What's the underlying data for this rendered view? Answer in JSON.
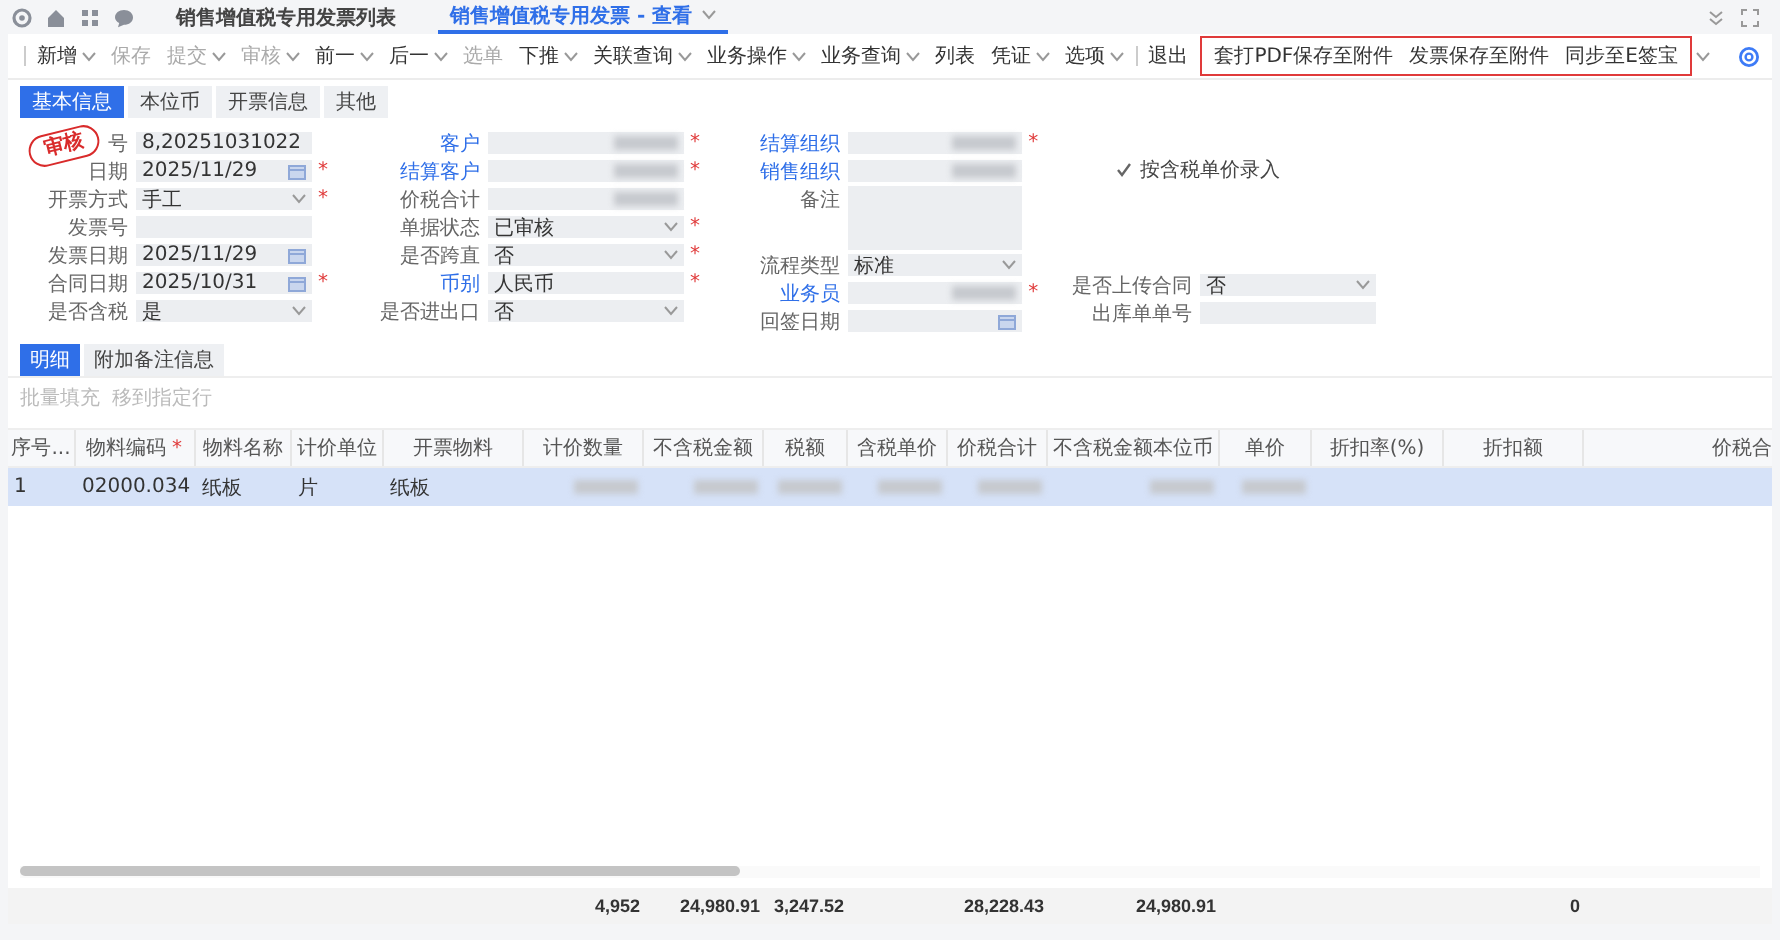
{
  "page_tabs": [
    {
      "label": "销售增值税专用发票列表",
      "selected": false,
      "closable": false
    },
    {
      "label": "销售增值税专用发票 - 查看",
      "selected": true,
      "closable": true
    }
  ],
  "toolbar": [
    {
      "kind": "separator"
    },
    {
      "kind": "button",
      "label": "新增",
      "dropdown": true,
      "disabled": false,
      "highlighted": false
    },
    {
      "kind": "button",
      "label": "保存",
      "dropdown": false,
      "disabled": true,
      "highlighted": false
    },
    {
      "kind": "button",
      "label": "提交",
      "dropdown": true,
      "disabled": true,
      "highlighted": false
    },
    {
      "kind": "button",
      "label": "审核",
      "dropdown": true,
      "disabled": true,
      "highlighted": false
    },
    {
      "kind": "button",
      "label": "前一",
      "dropdown": true,
      "disabled": false,
      "highlighted": false
    },
    {
      "kind": "button",
      "label": "后一",
      "dropdown": true,
      "disabled": false,
      "highlighted": false
    },
    {
      "kind": "button",
      "label": "选单",
      "dropdown": false,
      "disabled": true,
      "highlighted": false
    },
    {
      "kind": "button",
      "label": "下推",
      "dropdown": true,
      "disabled": false,
      "highlighted": false
    },
    {
      "kind": "button",
      "label": "关联查询",
      "dropdown": true,
      "disabled": false,
      "highlighted": false
    },
    {
      "kind": "button",
      "label": "业务操作",
      "dropdown": true,
      "disabled": false,
      "highlighted": false
    },
    {
      "kind": "button",
      "label": "业务查询",
      "dropdown": true,
      "disabled": false,
      "highlighted": false
    },
    {
      "kind": "button",
      "label": "列表",
      "dropdown": false,
      "disabled": false,
      "highlighted": false
    },
    {
      "kind": "button",
      "label": "凭证",
      "dropdown": true,
      "disabled": false,
      "highlighted": false
    },
    {
      "kind": "button",
      "label": "选项",
      "dropdown": true,
      "disabled": false,
      "highlighted": false
    },
    {
      "kind": "separator"
    },
    {
      "kind": "button",
      "label": "退出",
      "dropdown": false,
      "disabled": false,
      "highlighted": false
    },
    {
      "kind": "button",
      "label": "套打PDF保存至附件",
      "dropdown": false,
      "disabled": false,
      "highlighted": true
    },
    {
      "kind": "button",
      "label": "发票保存至附件",
      "dropdown": false,
      "disabled": false,
      "highlighted": true
    },
    {
      "kind": "button",
      "label": "同步至E签宝",
      "dropdown": false,
      "disabled": false,
      "highlighted": true
    }
  ],
  "form_tabs": [
    {
      "label": "基本信息",
      "selected": true
    },
    {
      "label": "本位币",
      "selected": false
    },
    {
      "label": "开票信息",
      "selected": false
    },
    {
      "label": "其他",
      "selected": false
    }
  ],
  "stamp": {
    "text": "审核"
  },
  "form_columns": [
    [
      {
        "label": "号",
        "kind": "text",
        "value": "8,20251031022"
      },
      {
        "label": "日期",
        "kind": "date",
        "value": "2025/11/29",
        "mark": "*"
      },
      {
        "label": "开票方式",
        "kind": "select",
        "value": "手工",
        "mark": "*"
      },
      {
        "label": "发票号",
        "kind": "text"
      },
      {
        "label": "发票日期",
        "kind": "date",
        "value": "2025/11/29"
      },
      {
        "label": "合同日期",
        "kind": "date",
        "value": "2025/10/31",
        "mark": "*"
      },
      {
        "label": "是否含税",
        "kind": "select",
        "value": "是"
      }
    ],
    [
      {
        "label": "客户",
        "kind": "blurred",
        "link": true,
        "mark": "*"
      },
      {
        "label": "结算客户",
        "kind": "blurred",
        "link": true,
        "mark": "*"
      },
      {
        "label": "价税合计",
        "kind": "blurred"
      },
      {
        "label": "单据状态",
        "kind": "select",
        "value": "已审核",
        "mark": "*"
      },
      {
        "label": "是否跨直",
        "kind": "select",
        "value": "否",
        "mark": "*"
      },
      {
        "label": "币别",
        "kind": "text",
        "value": "人民币",
        "link": true,
        "mark": "*"
      },
      {
        "label": "是否进出口",
        "kind": "select",
        "value": "否"
      }
    ],
    [
      {
        "label": "结算组织",
        "kind": "blurred",
        "link": true,
        "mark": "*"
      },
      {
        "label": "销售组织",
        "kind": "blurred",
        "link": true
      },
      {
        "label": "备注",
        "kind": "textarea"
      },
      {
        "label": "流程类型",
        "kind": "select",
        "value": "标准"
      },
      {
        "label": "业务员",
        "kind": "blurred",
        "link": true,
        "mark": "*"
      },
      {
        "label": "回签日期",
        "kind": "date"
      }
    ],
    [
      {
        "label": "按含税单价录入",
        "kind": "checkbox",
        "checked": true
      },
      {
        "label": "是否上传合同",
        "kind": "select",
        "value": "否"
      },
      {
        "label": "出库单单号",
        "kind": "text"
      }
    ]
  ],
  "detail_tabs": [
    {
      "label": "明细",
      "selected": true
    },
    {
      "label": "附加备注信息",
      "selected": false
    }
  ],
  "detail_actions": [
    {
      "label": "批量填充",
      "disabled": true
    },
    {
      "label": "移到指定行",
      "disabled": true
    }
  ],
  "table": {
    "columns": [
      {
        "label": "序号..."
      },
      {
        "label": "物料编码",
        "mark": "*"
      },
      {
        "label": "物料名称"
      },
      {
        "label": "计价单位"
      },
      {
        "label": "开票物料"
      },
      {
        "label": "计价数量",
        "total": "4,952"
      },
      {
        "label": "不含税金额",
        "total": "24,980.91"
      },
      {
        "label": "税额",
        "total": "3,247.52"
      },
      {
        "label": "含税单价"
      },
      {
        "label": "价税合计",
        "total": "28,228.43"
      },
      {
        "label": "不含税金额本位币",
        "total": "24,980.91"
      },
      {
        "label": "单价"
      },
      {
        "label": "折扣率(%)"
      },
      {
        "label": "折扣额",
        "total": "0"
      },
      {
        "label": "价税合"
      }
    ],
    "rows": [
      {
        "selected": true,
        "cells": [
          {
            "kind": "text",
            "text": "1"
          },
          {
            "kind": "text",
            "text": "02000.034"
          },
          {
            "kind": "text",
            "text": "纸板"
          },
          {
            "kind": "text",
            "text": "片"
          },
          {
            "kind": "text",
            "text": "纸板"
          },
          {
            "kind": "blurred"
          },
          {
            "kind": "blurred"
          },
          {
            "kind": "blurred"
          },
          {
            "kind": "blurred"
          },
          {
            "kind": "blurred"
          },
          {
            "kind": "blurred"
          },
          {
            "kind": "blurred"
          },
          {
            "kind": "blank"
          },
          {
            "kind": "blank"
          },
          {
            "kind": "blank"
          }
        ]
      }
    ]
  }
}
